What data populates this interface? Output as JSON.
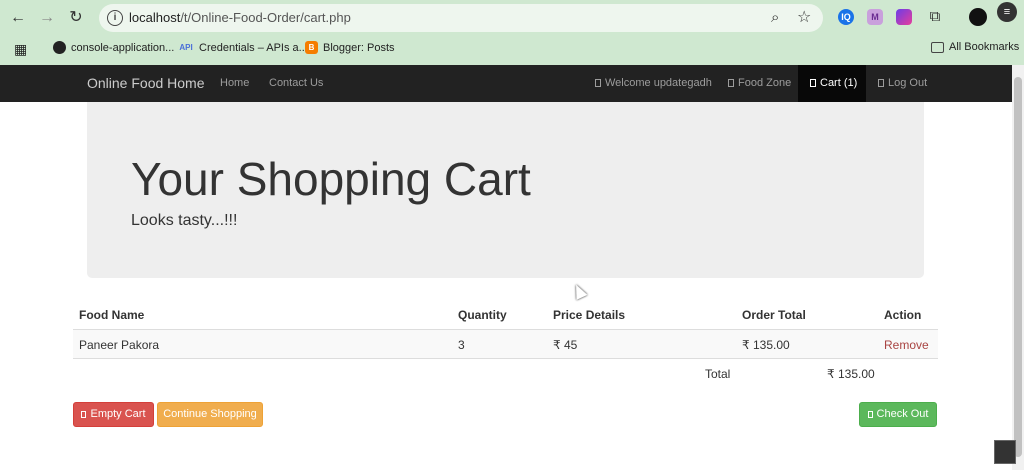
{
  "browser": {
    "url_host": "localhost",
    "url_path": "/t/Online-Food-Order/cart.php",
    "bookmarks": [
      {
        "label": "console-application..."
      },
      {
        "label": "Credentials – APIs a..."
      },
      {
        "label": "Blogger: Posts"
      }
    ],
    "all_bookmarks": "All Bookmarks",
    "api_badge": "API",
    "ext_labels": [
      "IQ",
      "M"
    ]
  },
  "navbar": {
    "brand": "Online Food Home",
    "links": [
      "Home",
      "Contact Us"
    ],
    "right": [
      "Welcome updategadh",
      "Food Zone",
      "Cart (1)",
      "Log Out"
    ]
  },
  "jumbotron": {
    "title": "Your Shopping Cart",
    "subtitle": "Looks tasty...!!!"
  },
  "cart": {
    "headers": [
      "Food Name",
      "Quantity",
      "Price Details",
      "Order Total",
      "Action"
    ],
    "rows": [
      {
        "name": "Paneer Pakora",
        "quantity": "3",
        "price": "₹ 45",
        "total": "₹ 135.00",
        "action": "Remove"
      }
    ],
    "total_label": "Total",
    "total_value": "₹ 135.00"
  },
  "buttons": {
    "empty": "Empty Cart",
    "continue": "Continue Shopping",
    "checkout": "Check Out"
  },
  "colors": {
    "danger": "#d9534f",
    "warning": "#f0ad4e",
    "success": "#5cb85c",
    "navbar": "#222222"
  }
}
